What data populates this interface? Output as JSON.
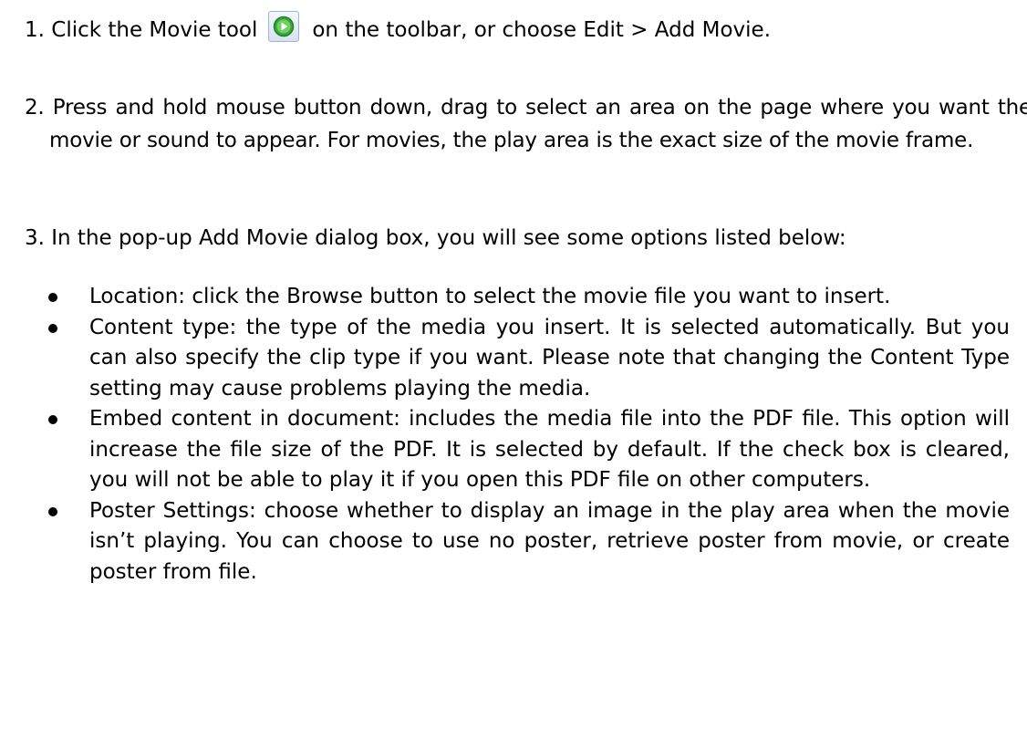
{
  "steps": [
    {
      "before_icon": "1. Click the Movie tool",
      "icon": "movie-tool-icon",
      "after_icon": "on the toolbar, or choose Edit > Add Movie."
    },
    {
      "text": "2. Press and hold mouse button down, drag to select an area on the page where you want the movie or sound to appear. For movies, the play area is the exact size of the movie frame."
    },
    {
      "text": "3. In the pop-up Add Movie dialog box, you will see some options listed below:"
    }
  ],
  "options": [
    "Location: click the Browse button to select the movie file you want to insert.",
    "Content type: the type of the media you insert. It is selected automatically. But you can also specify the clip type if you want. Please note that changing the Content Type setting may cause problems playing the media.",
    "Embed content in document: includes the media file into the PDF file. This option will increase the file size of the PDF. It is selected by default. If the check box is cleared, you will not be able to play it if you open this PDF file on other computers.",
    "Poster Settings: choose whether to display an image in the play area when the movie isn’t playing. You can choose to use no poster, retrieve poster from movie, or create poster from file."
  ],
  "colors": {
    "text": "#000000",
    "icon_green": "#3aa53a",
    "icon_frame": "#9fb6cc"
  }
}
